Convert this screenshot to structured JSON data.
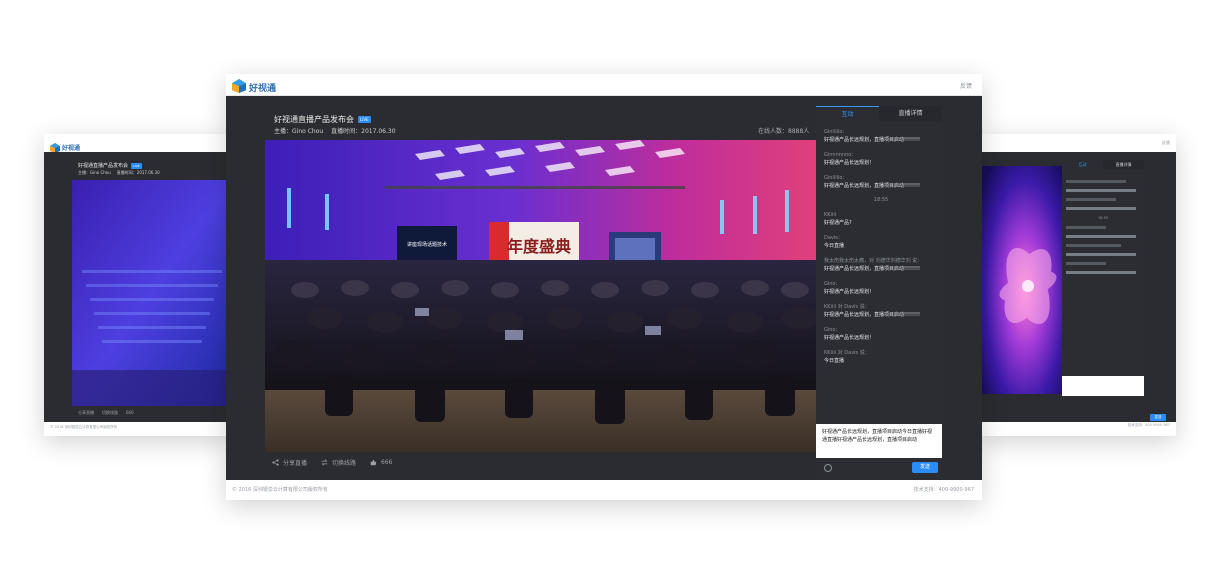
{
  "brand": {
    "name": "好视通",
    "feedback": "反馈"
  },
  "stream": {
    "title": "好视通直播产品发布会",
    "live_badge": "LIVE",
    "host": "主播：Gino Chou",
    "time": "直播时间：2017.06.30",
    "online": "在线人数：8888人"
  },
  "video": {
    "screen_text": "年度盛典",
    "side_screen_text": "讲座现场话题技术"
  },
  "actions": {
    "share": "分享直播",
    "switch": "切换线路",
    "likes": "666"
  },
  "chat": {
    "tabs": [
      "互动",
      "直播详情"
    ],
    "messages": [
      {
        "user": "Ginlililo：",
        "text": "好视通产品长远规划，直播项目启动!!!!!!!!"
      },
      {
        "user": "Ginnnnnno：",
        "text": "好视通产品长远规划！"
      },
      {
        "user": "Ginlililo：",
        "text": "好视通产品长远规划，直播项目启动!!!!!!!!"
      },
      {
        "time": "18:55"
      },
      {
        "user": "KKiiii",
        "text": "好视通产品?"
      },
      {
        "user": "Davis：",
        "text": "今日直播"
      },
      {
        "user": "我太伤我太伤太痛，对 刘德华刘德华刘 说：",
        "text": "好视通产品长远规划，直播项目启动!!!!!!!!"
      },
      {
        "user": "Gino：",
        "text": "好视通产品长远规划！"
      },
      {
        "user": "KKiiii  对 Davis 说：",
        "text": "好视通产品长远规划，直播项目启动!!!!!!!!"
      },
      {
        "user": "Gino：",
        "text": "好视通产品长远规划！"
      },
      {
        "user": "KKiiii  对 Davis 说：",
        "text": "今日直播"
      }
    ],
    "compose_text": "好视通产品长远规划，直播项目启动今日直播好视通直播好视通产品长远规划，直播项目启动",
    "send": "发送"
  },
  "footer": {
    "copyright": "© 2016 深圳银澎云计算有限公司版权所有",
    "support": "技术支持：400-9900-967"
  },
  "side_left": {
    "title": "好视通直播产品发布会",
    "live_badge": "LIVE",
    "host": "主播：Gino Chou",
    "time": "直播时间：2017.06.30",
    "share": "分享直播",
    "switch": "切换线路",
    "likes": "666",
    "copyright": "© 2016 深圳银澎云计算有限公司版权所有",
    "logo_text": "好视通"
  },
  "side_right": {
    "feedback": "反馈",
    "tabs": [
      "互动",
      "直播详情"
    ],
    "support": "技术支持：400-9900-967",
    "send": "发送",
    "time": "18:55"
  },
  "colors": {
    "accent": "#2b8cf5",
    "dark_bg": "#2a2c31",
    "logo": "#2f6fb5"
  }
}
